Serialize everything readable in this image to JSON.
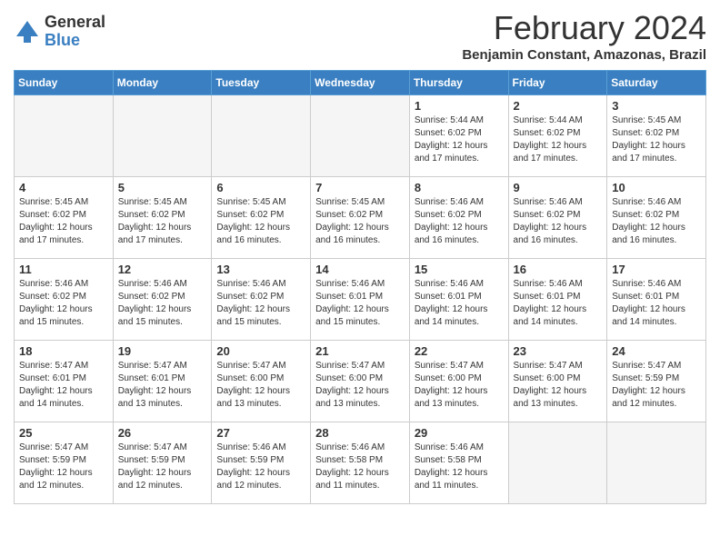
{
  "logo": {
    "general": "General",
    "blue": "Blue"
  },
  "title": "February 2024",
  "location": "Benjamin Constant, Amazonas, Brazil",
  "weekdays": [
    "Sunday",
    "Monday",
    "Tuesday",
    "Wednesday",
    "Thursday",
    "Friday",
    "Saturday"
  ],
  "weeks": [
    [
      {
        "day": "",
        "info": ""
      },
      {
        "day": "",
        "info": ""
      },
      {
        "day": "",
        "info": ""
      },
      {
        "day": "",
        "info": ""
      },
      {
        "day": "1",
        "info": "Sunrise: 5:44 AM\nSunset: 6:02 PM\nDaylight: 12 hours\nand 17 minutes."
      },
      {
        "day": "2",
        "info": "Sunrise: 5:44 AM\nSunset: 6:02 PM\nDaylight: 12 hours\nand 17 minutes."
      },
      {
        "day": "3",
        "info": "Sunrise: 5:45 AM\nSunset: 6:02 PM\nDaylight: 12 hours\nand 17 minutes."
      }
    ],
    [
      {
        "day": "4",
        "info": "Sunrise: 5:45 AM\nSunset: 6:02 PM\nDaylight: 12 hours\nand 17 minutes."
      },
      {
        "day": "5",
        "info": "Sunrise: 5:45 AM\nSunset: 6:02 PM\nDaylight: 12 hours\nand 17 minutes."
      },
      {
        "day": "6",
        "info": "Sunrise: 5:45 AM\nSunset: 6:02 PM\nDaylight: 12 hours\nand 16 minutes."
      },
      {
        "day": "7",
        "info": "Sunrise: 5:45 AM\nSunset: 6:02 PM\nDaylight: 12 hours\nand 16 minutes."
      },
      {
        "day": "8",
        "info": "Sunrise: 5:46 AM\nSunset: 6:02 PM\nDaylight: 12 hours\nand 16 minutes."
      },
      {
        "day": "9",
        "info": "Sunrise: 5:46 AM\nSunset: 6:02 PM\nDaylight: 12 hours\nand 16 minutes."
      },
      {
        "day": "10",
        "info": "Sunrise: 5:46 AM\nSunset: 6:02 PM\nDaylight: 12 hours\nand 16 minutes."
      }
    ],
    [
      {
        "day": "11",
        "info": "Sunrise: 5:46 AM\nSunset: 6:02 PM\nDaylight: 12 hours\nand 15 minutes."
      },
      {
        "day": "12",
        "info": "Sunrise: 5:46 AM\nSunset: 6:02 PM\nDaylight: 12 hours\nand 15 minutes."
      },
      {
        "day": "13",
        "info": "Sunrise: 5:46 AM\nSunset: 6:02 PM\nDaylight: 12 hours\nand 15 minutes."
      },
      {
        "day": "14",
        "info": "Sunrise: 5:46 AM\nSunset: 6:01 PM\nDaylight: 12 hours\nand 15 minutes."
      },
      {
        "day": "15",
        "info": "Sunrise: 5:46 AM\nSunset: 6:01 PM\nDaylight: 12 hours\nand 14 minutes."
      },
      {
        "day": "16",
        "info": "Sunrise: 5:46 AM\nSunset: 6:01 PM\nDaylight: 12 hours\nand 14 minutes."
      },
      {
        "day": "17",
        "info": "Sunrise: 5:46 AM\nSunset: 6:01 PM\nDaylight: 12 hours\nand 14 minutes."
      }
    ],
    [
      {
        "day": "18",
        "info": "Sunrise: 5:47 AM\nSunset: 6:01 PM\nDaylight: 12 hours\nand 14 minutes."
      },
      {
        "day": "19",
        "info": "Sunrise: 5:47 AM\nSunset: 6:01 PM\nDaylight: 12 hours\nand 13 minutes."
      },
      {
        "day": "20",
        "info": "Sunrise: 5:47 AM\nSunset: 6:00 PM\nDaylight: 12 hours\nand 13 minutes."
      },
      {
        "day": "21",
        "info": "Sunrise: 5:47 AM\nSunset: 6:00 PM\nDaylight: 12 hours\nand 13 minutes."
      },
      {
        "day": "22",
        "info": "Sunrise: 5:47 AM\nSunset: 6:00 PM\nDaylight: 12 hours\nand 13 minutes."
      },
      {
        "day": "23",
        "info": "Sunrise: 5:47 AM\nSunset: 6:00 PM\nDaylight: 12 hours\nand 13 minutes."
      },
      {
        "day": "24",
        "info": "Sunrise: 5:47 AM\nSunset: 5:59 PM\nDaylight: 12 hours\nand 12 minutes."
      }
    ],
    [
      {
        "day": "25",
        "info": "Sunrise: 5:47 AM\nSunset: 5:59 PM\nDaylight: 12 hours\nand 12 minutes."
      },
      {
        "day": "26",
        "info": "Sunrise: 5:47 AM\nSunset: 5:59 PM\nDaylight: 12 hours\nand 12 minutes."
      },
      {
        "day": "27",
        "info": "Sunrise: 5:46 AM\nSunset: 5:59 PM\nDaylight: 12 hours\nand 12 minutes."
      },
      {
        "day": "28",
        "info": "Sunrise: 5:46 AM\nSunset: 5:58 PM\nDaylight: 12 hours\nand 11 minutes."
      },
      {
        "day": "29",
        "info": "Sunrise: 5:46 AM\nSunset: 5:58 PM\nDaylight: 12 hours\nand 11 minutes."
      },
      {
        "day": "",
        "info": ""
      },
      {
        "day": "",
        "info": ""
      }
    ]
  ]
}
